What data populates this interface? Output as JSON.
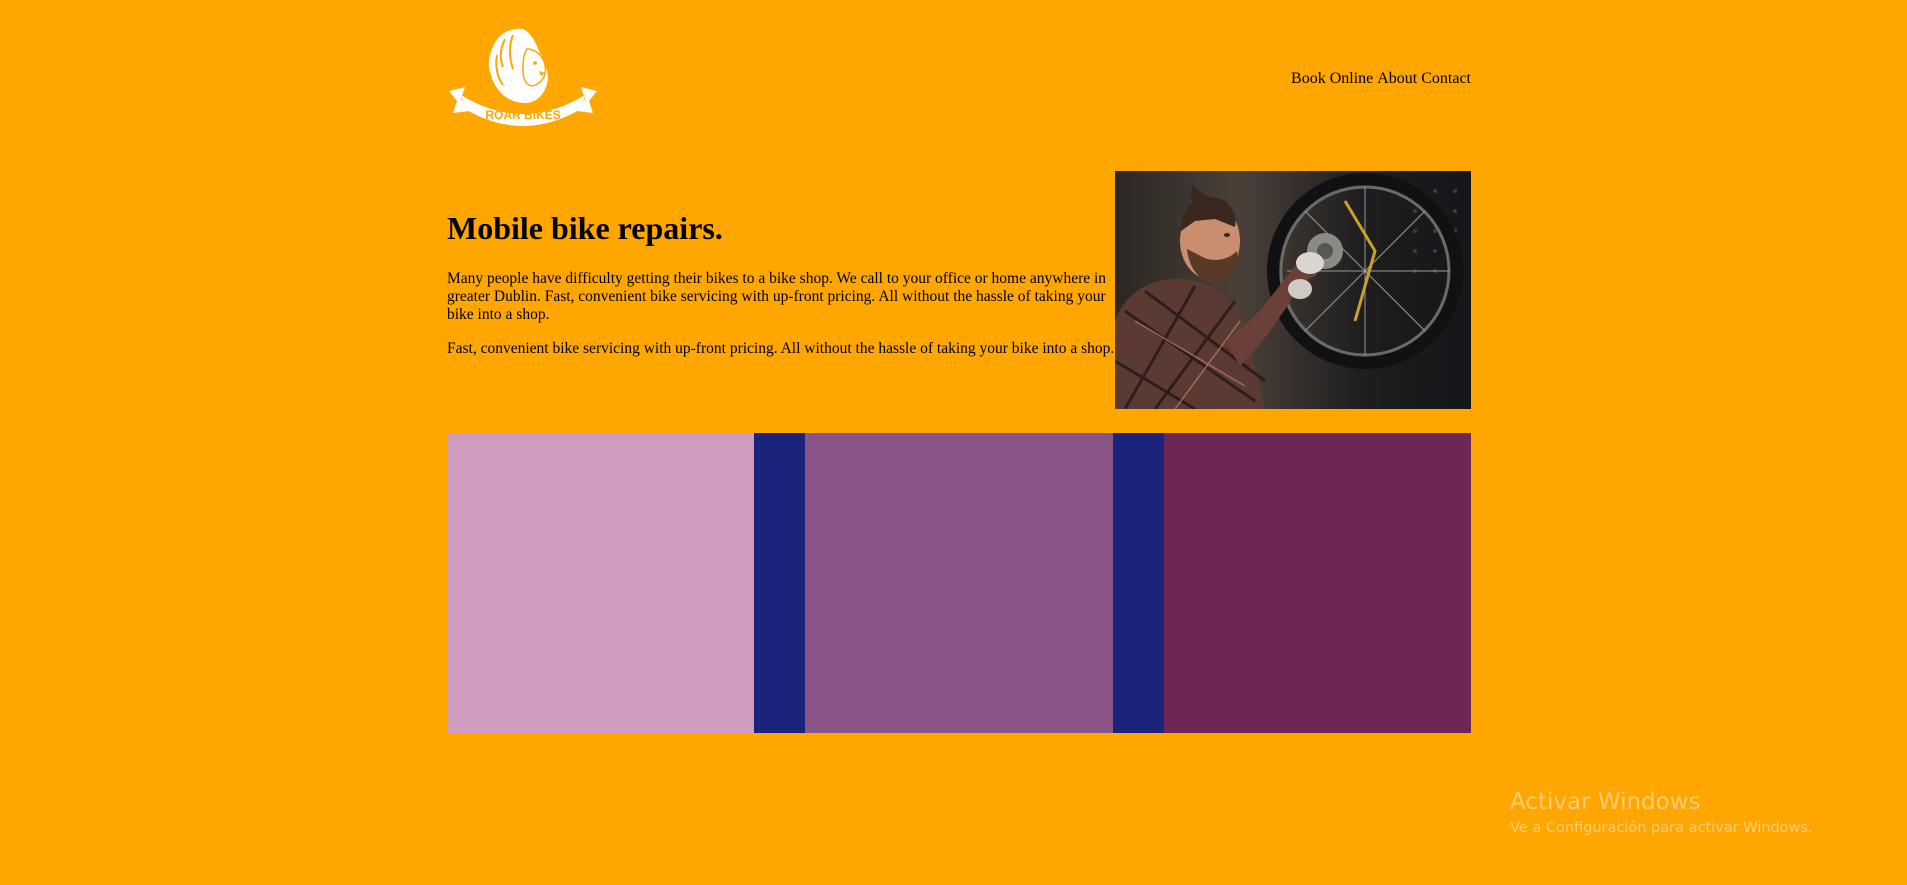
{
  "brand": {
    "name": "ROAR BIKES"
  },
  "nav": {
    "items": [
      {
        "label": "Book Online"
      },
      {
        "label": "About"
      },
      {
        "label": "Contact"
      }
    ]
  },
  "hero": {
    "title": "Mobile bike repairs.",
    "paragraph1": "Many people have difficulty getting their bikes to a bike shop. We call to your office or home anywhere in greater Dublin. Fast, convenient bike servicing with up-front pricing. All without the hassle of taking your bike into a shop.",
    "paragraph2": "Fast, convenient bike servicing with up-front pricing. All without the hassle of taking your bike into a shop.",
    "image_icon": "mechanic-photo"
  },
  "blocks": {
    "colors": [
      "#cd9cbf",
      "#1b237b",
      "#8a5487",
      "#1b237b",
      "#6c2755"
    ]
  },
  "os_watermark": {
    "title": "Activar Windows",
    "subtitle": "Ve a Configuración para activar Windows."
  },
  "colors": {
    "background": "#ffa600",
    "text": "#000000"
  }
}
